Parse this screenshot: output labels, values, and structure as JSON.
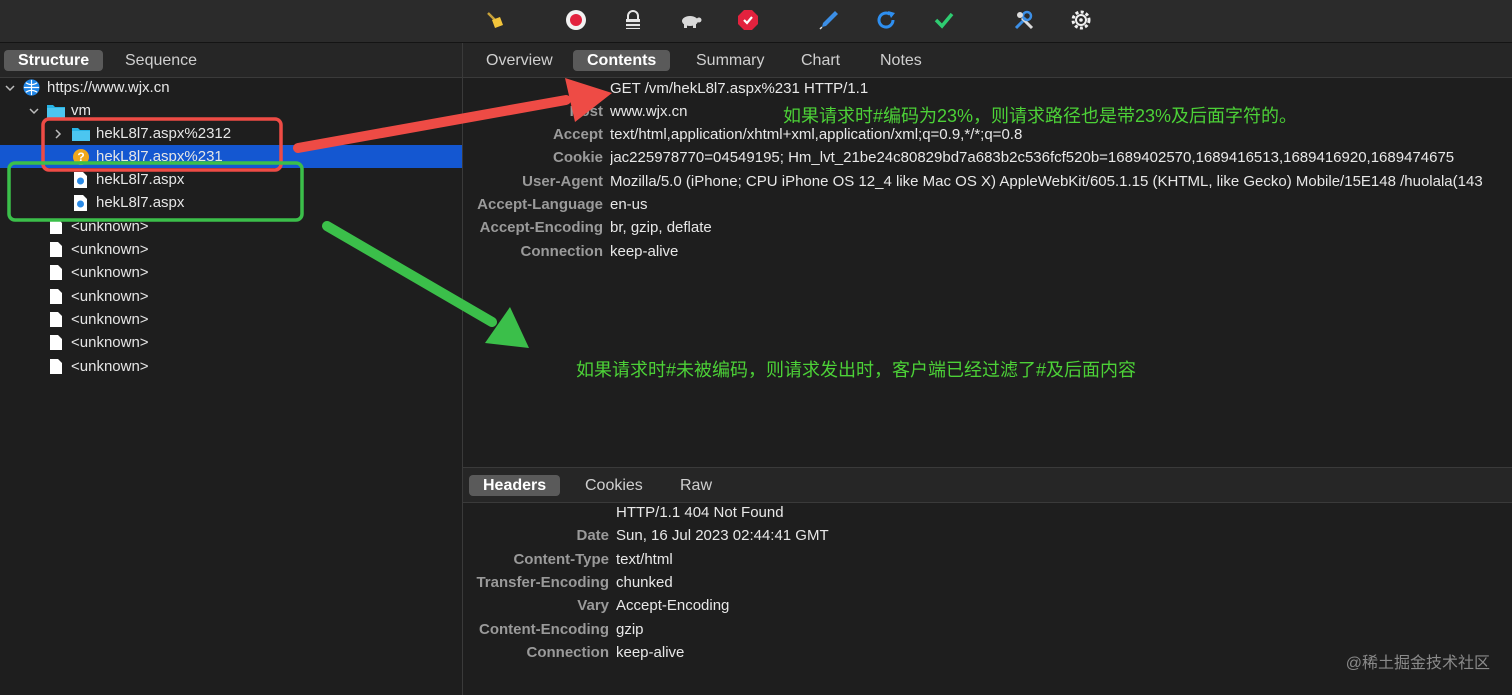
{
  "toolbar": {
    "icons": [
      "broom-icon",
      "record-icon",
      "lock-icon",
      "turtle-icon",
      "stop-icon",
      "pen-icon",
      "refresh-icon",
      "check-icon",
      "tools-icon",
      "gear-icon"
    ]
  },
  "left_tabs": {
    "structure": "Structure",
    "sequence": "Sequence"
  },
  "tree": {
    "host": "https://www.wjx.cn",
    "folder": "vm",
    "items": [
      {
        "label": "hekL8l7.aspx%2312",
        "type": "folder"
      },
      {
        "label": "hekL8l7.aspx%231",
        "type": "pending"
      },
      {
        "label": "hekL8l7.aspx",
        "type": "file"
      },
      {
        "label": "hekL8l7.aspx",
        "type": "file"
      }
    ],
    "unknown": [
      "<unknown>",
      "<unknown>",
      "<unknown>",
      "<unknown>",
      "<unknown>",
      "<unknown>",
      "<unknown>"
    ]
  },
  "top_tabs": {
    "overview": "Overview",
    "contents": "Contents",
    "summary": "Summary",
    "chart": "Chart",
    "notes": "Notes"
  },
  "request": {
    "line": "GET /vm/hekL8l7.aspx%231 HTTP/1.1",
    "headers": [
      {
        "k": "Host",
        "v": "www.wjx.cn"
      },
      {
        "k": "Accept",
        "v": "text/html,application/xhtml+xml,application/xml;q=0.9,*/*;q=0.8"
      },
      {
        "k": "Cookie",
        "v": "jac225978770=04549195; Hm_lvt_21be24c80829bd7a683b2c536fcf520b=1689402570,1689416513,1689416920,1689474675"
      },
      {
        "k": "User-Agent",
        "v": "Mozilla/5.0 (iPhone; CPU iPhone OS 12_4 like Mac OS X) AppleWebKit/605.1.15 (KHTML, like Gecko) Mobile/15E148 /huolala(143"
      },
      {
        "k": "Accept-Language",
        "v": "en-us"
      },
      {
        "k": "Accept-Encoding",
        "v": "br, gzip, deflate"
      },
      {
        "k": "Connection",
        "v": "keep-alive"
      }
    ]
  },
  "bottom_tabs": {
    "headers": "Headers",
    "cookies": "Cookies",
    "raw": "Raw"
  },
  "response": {
    "line": "HTTP/1.1 404 Not Found",
    "headers": [
      {
        "k": "Date",
        "v": "Sun, 16 Jul 2023 02:44:41 GMT"
      },
      {
        "k": "Content-Type",
        "v": "text/html"
      },
      {
        "k": "Transfer-Encoding",
        "v": "chunked"
      },
      {
        "k": "Vary",
        "v": "Accept-Encoding"
      },
      {
        "k": "Content-Encoding",
        "v": "gzip"
      },
      {
        "k": "Connection",
        "v": "keep-alive"
      }
    ]
  },
  "annotations": {
    "top": "如果请求时#编码为23%，则请求路径也是带23%及后面字符的。",
    "bottom": "如果请求时#未被编码，则请求发出时，客户端已经过滤了#及后面内容"
  },
  "watermark": "@稀土掘金技术社区",
  "colors": {
    "selection": "#1457d1",
    "red_annotation": "#ee4b45",
    "green_annotation": "#3bbf4a",
    "annotation_text": "#4cd137"
  }
}
